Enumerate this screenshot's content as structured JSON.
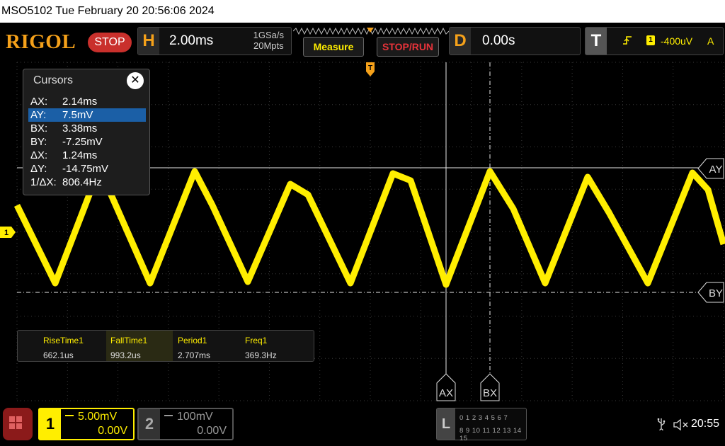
{
  "title_bar": {
    "text": "MSO5102  Tue February 20 20:56:06 2024"
  },
  "toolbar": {
    "logo": "RIGOL",
    "run_state": "STOP",
    "horizontal": {
      "letter": "H",
      "timebase": "2.00ms",
      "sample_rate": "1GSa/s",
      "memory_depth": "20Mpts"
    },
    "measure_label": "Measure",
    "stop_run_label": "STOP/RUN",
    "delay": {
      "letter": "D",
      "value": "0.00s"
    },
    "trigger": {
      "letter": "T",
      "source": "1",
      "level": "-400uV",
      "coupling": "A",
      "edge_icon": "rising-edge-icon"
    }
  },
  "cursors": {
    "title": "Cursors",
    "rows": [
      {
        "key": "AX:",
        "value": "2.14ms"
      },
      {
        "key": "AY:",
        "value": "7.5mV"
      },
      {
        "key": "BX:",
        "value": "3.38ms"
      },
      {
        "key": "BY:",
        "value": "-7.25mV"
      },
      {
        "key": "ΔX:",
        "value": "1.24ms"
      },
      {
        "key": "ΔY:",
        "value": "-14.75mV"
      },
      {
        "key": "1/ΔX:",
        "value": "806.4Hz"
      }
    ],
    "selected_index": 1,
    "markers": {
      "ax": "AX",
      "bx": "BX",
      "ay": "AY",
      "by": "BY"
    }
  },
  "channel_marker": "1",
  "measurements": [
    {
      "label": "RiseTime1",
      "value": "662.1us"
    },
    {
      "label": "FallTime1",
      "value": "993.2us"
    },
    {
      "label": "Period1",
      "value": "2.707ms"
    },
    {
      "label": "Freq1",
      "value": "369.3Hz"
    }
  ],
  "channels": {
    "ch1": {
      "number": "1",
      "scale": "5.00mV",
      "offset": "0.00V",
      "color": "#ffee00"
    },
    "ch2": {
      "number": "2",
      "scale": "100mV",
      "offset": "0.00V",
      "color": "#999999"
    }
  },
  "logic_analyzer": {
    "label": "L",
    "bits_row1": "0 1 2 3  4 5 6 7",
    "bits_row2": "8 9 10 11 12 13 14 15"
  },
  "status": {
    "usb_icon": "usb-icon",
    "sound_icon": "mute-icon",
    "time": "20:55"
  },
  "colors": {
    "accent": "#f5a11a",
    "ch1": "#ffee00",
    "stop": "#c9302c",
    "selection": "#1b5fa6"
  }
}
